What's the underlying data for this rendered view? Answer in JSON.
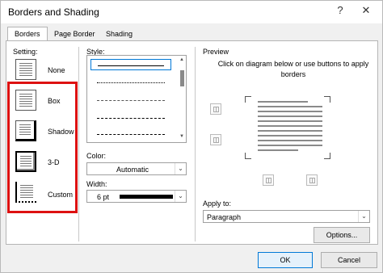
{
  "window": {
    "title": "Borders and Shading",
    "help_icon": "?",
    "close_icon": "✕"
  },
  "tabs": [
    {
      "label": "Borders",
      "active": true
    },
    {
      "label": "Page Border",
      "active": false
    },
    {
      "label": "Shading",
      "active": false
    }
  ],
  "setting": {
    "label": "Setting:",
    "options": [
      {
        "label": "None",
        "selected": false
      },
      {
        "label": "Box",
        "selected": false
      },
      {
        "label": "Shadow",
        "selected": false
      },
      {
        "label": "3-D",
        "selected": false
      },
      {
        "label": "Custom",
        "selected": true
      }
    ]
  },
  "style": {
    "label": "Style:",
    "items": [
      "solid",
      "dotted",
      "dashed-fine",
      "dashed",
      "dash-dot"
    ]
  },
  "color": {
    "label": "Color:",
    "value": "Automatic"
  },
  "width": {
    "label": "Width:",
    "value": "6 pt"
  },
  "preview": {
    "label": "Preview",
    "instructions": "Click on diagram below or use buttons to apply borders"
  },
  "apply_to": {
    "label": "Apply to:",
    "value": "Paragraph"
  },
  "buttons": {
    "options": "Options...",
    "ok": "OK",
    "cancel": "Cancel"
  },
  "colors": {
    "highlight": "#d11111",
    "accent": "#0078d7"
  }
}
